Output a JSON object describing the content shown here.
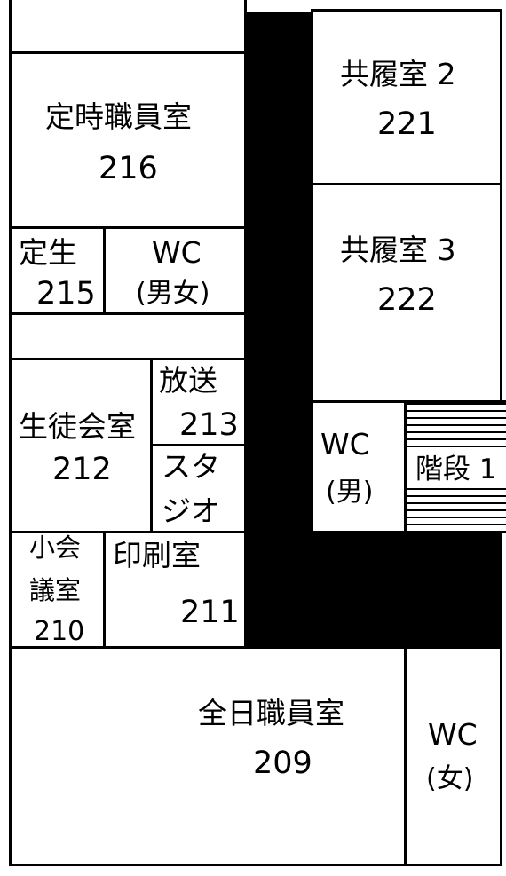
{
  "rooms": {
    "r221": {
      "name": "共履室 2",
      "number": "221"
    },
    "r222": {
      "name": "共履室 3",
      "number": "222"
    },
    "r216": {
      "name": "定時職員室",
      "number": "216"
    },
    "r215": {
      "name": "定生",
      "number": "215"
    },
    "wc_mixed": {
      "name": "WC",
      "sub": "(男女)"
    },
    "r213": {
      "name": "放送",
      "number": "213"
    },
    "studio": {
      "line1": "スタ",
      "line2": "ジオ"
    },
    "r212": {
      "name": "生徒会室",
      "number": "212"
    },
    "wc_male": {
      "name": "WC",
      "sub": "(男)"
    },
    "stairs1": {
      "name": "階段 1"
    },
    "r210": {
      "line1": "小会",
      "line2": "議室",
      "number": "210"
    },
    "r211": {
      "name": "印刷室",
      "number": "211"
    },
    "r209": {
      "name": "全日職員室",
      "number": "209"
    },
    "wc_female": {
      "name": "WC",
      "sub": "(女)"
    }
  }
}
